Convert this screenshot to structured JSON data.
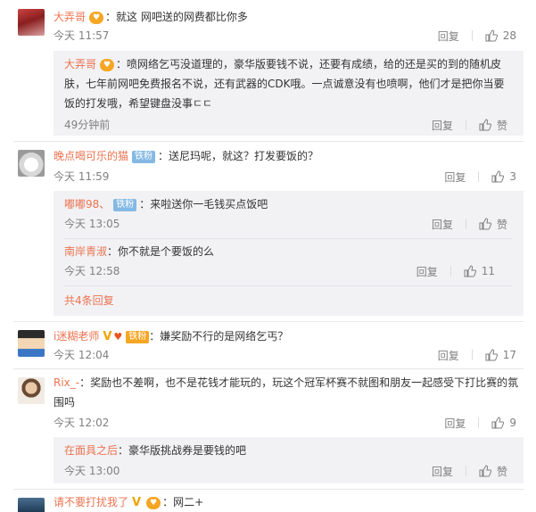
{
  "labels": {
    "reply": "回复",
    "like": "赞"
  },
  "comments": [
    {
      "user": "大弄哥",
      "sep": "：",
      "text": "就这 网吧送的网费都比你多",
      "time": "今天 11:57",
      "likes": "28",
      "replies": [
        {
          "user": "大弄哥",
          "sep": "：",
          "text_line1": "喷网络乞丐没道理的，豪华版要钱不说，还要有成绩，给的还是买的到的随机皮",
          "text_line2": "肤，七年前网吧免费报名不说，还有武器的CDK哦。一点诚意没有也喷啊，他们才是把你当要",
          "text_line3": "饭的打发哦，希望键盘没事ㄷㄷ",
          "time": "49分钟前",
          "likes": "赞"
        }
      ]
    },
    {
      "user": "晚点喝可乐的猫",
      "badge": "铁粉",
      "sep": "：",
      "text": "送尼玛呢，就这？打发要饭的？",
      "time": "今天 11:59",
      "likes": "3",
      "replies": [
        {
          "user": "嘟嘟98、",
          "badge": "铁粉",
          "sep": "：",
          "text": "来啦送你一毛钱买点饭吧",
          "time": "今天 13:05",
          "likes": "赞"
        },
        {
          "user": "南岸青淑",
          "sep": "：",
          "text": "你不就是个要饭的么",
          "time": "今天 12:58",
          "likes": "11"
        }
      ],
      "more": "共4条回复"
    },
    {
      "user": "i迷糊老师",
      "badge": "铁粉",
      "sep": "：",
      "text": "嫌奖励不行的是网络乞丐？",
      "time": "今天 12:04",
      "likes": "17"
    },
    {
      "user": "Rix_-",
      "sep": "：",
      "text_line1": "奖励也不差啊，也不是花钱才能玩的，玩这个冠军杯赛不就图和朋友一起感受下打比赛的氛",
      "text_line2": "围吗",
      "time": "今天 12:02",
      "likes": "9",
      "replies": [
        {
          "user": "在面具之后",
          "sep": "：",
          "text": "豪华版挑战券是要钱的吧",
          "time": "今天 13:00",
          "likes": "赞"
        }
      ]
    },
    {
      "user": "请不要打扰我了",
      "sep": "：",
      "text": "网二+"
    }
  ]
}
